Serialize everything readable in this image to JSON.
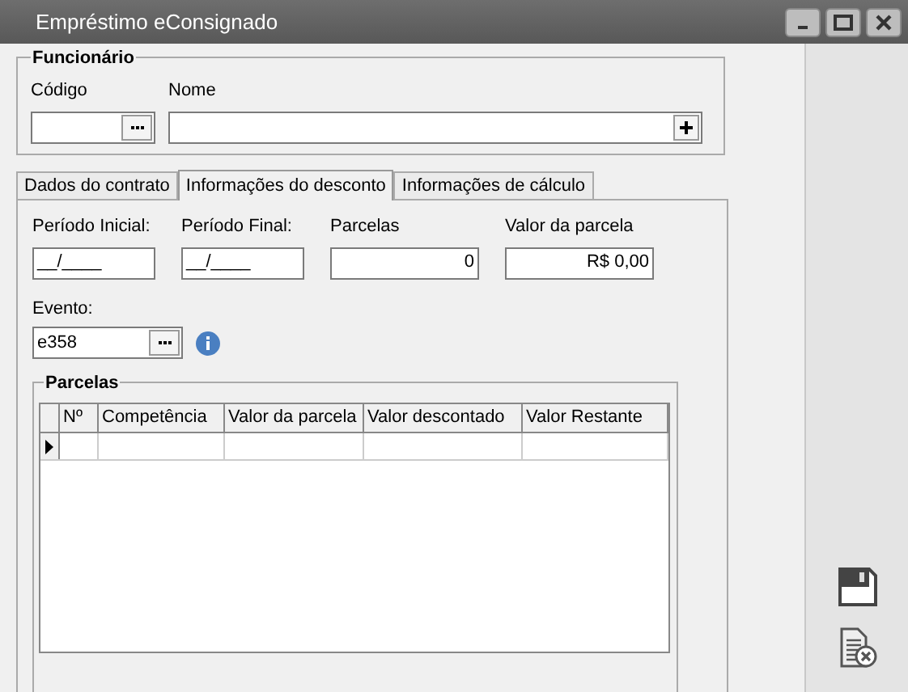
{
  "window": {
    "title": "Empréstimo eConsignado"
  },
  "employee": {
    "title": "Funcionário",
    "code_label": "Código",
    "name_label": "Nome"
  },
  "tabs": [
    {
      "label": "Dados do contrato",
      "selected": false
    },
    {
      "label": "Informações do desconto",
      "selected": true
    },
    {
      "label": "Informações de cálculo",
      "selected": false
    }
  ],
  "fields": [
    {
      "label": "Período Inicial:",
      "value": "__/____",
      "kind": "date"
    },
    {
      "label": "Período Final:",
      "value": "__/____",
      "kind": "date"
    },
    {
      "label": "Parcelas",
      "value": "0",
      "kind": "number"
    },
    {
      "label": "Valor da parcela",
      "value": "R$ 0,00",
      "kind": "number"
    }
  ],
  "evento": {
    "label": "Evento:",
    "value": "e358"
  },
  "parcelas": {
    "title": "Parcelas",
    "columns": [
      "Nº",
      "Competência",
      "Valor da parcela",
      "Valor descontado",
      "Valor Restante"
    ]
  }
}
